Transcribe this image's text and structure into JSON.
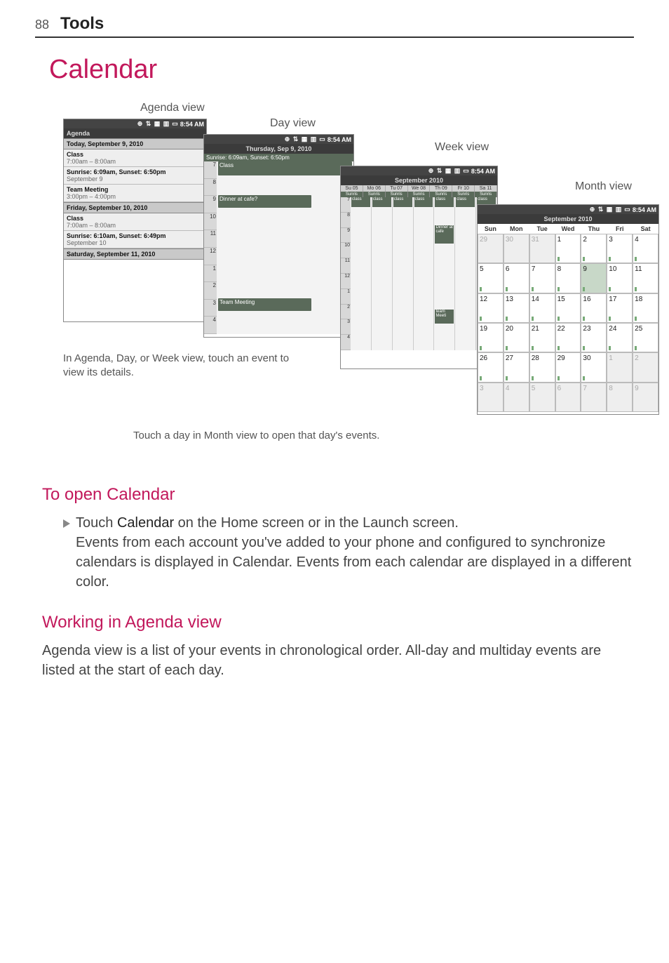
{
  "page": {
    "number": "88",
    "header": "Tools"
  },
  "title": "Calendar",
  "labels": {
    "agenda": "Agenda view",
    "day": "Day view",
    "week": "Week view",
    "month": "Month view"
  },
  "statusbar": {
    "icons": "⊕ ⇅ ▦ ▥",
    "battery": "▭",
    "time": "8:54 AM"
  },
  "agenda": {
    "title": "Agenda",
    "today": "Today, September 9, 2010",
    "items": [
      {
        "title": "Class",
        "sub": "7:00am – 8:00am"
      },
      {
        "title": "Sunrise: 6:09am, Sunset: 6:50pm",
        "sub": "September 9"
      },
      {
        "title": "Team Meeting",
        "sub": "3:00pm – 4:00pm"
      }
    ],
    "friday": "Friday, September 10, 2010",
    "friday_items": [
      {
        "title": "Class",
        "sub": "7:00am – 8:00am"
      },
      {
        "title": "Sunrise: 6:10am, Sunset: 6:49pm",
        "sub": "September 10"
      }
    ],
    "saturday": "Saturday, September 11, 2010"
  },
  "day": {
    "header": "Thursday, Sep 9, 2010",
    "sun": "Sunrise: 6:09am, Sunset: 6:50pm",
    "ev7": "Class",
    "ev9": "Dinner at cafe?",
    "ev3": "Team Meeting",
    "hours": [
      "7",
      "8",
      "9",
      "10",
      "11",
      "12",
      "1",
      "2",
      "3",
      "4"
    ]
  },
  "week": {
    "header": "September 2010",
    "days": [
      "Su 05",
      "Mo 06",
      "Tu 07",
      "We 08",
      "Th 09",
      "Fr 10",
      "Sa 11"
    ],
    "sun": [
      "Sunris",
      "Sunris",
      "Sunris",
      "Sunris",
      "Sunris",
      "Sunris",
      "Sunris"
    ],
    "class": [
      "class",
      "class",
      "class",
      "class",
      "class",
      "class",
      "class"
    ],
    "hours": [
      "7",
      "8",
      "9",
      "10",
      "11",
      "12",
      "1",
      "2",
      "3",
      "4"
    ],
    "dinner": "Dinner at cafe",
    "team": "team Meeti"
  },
  "month": {
    "header": "September 2010",
    "dow": [
      "Sun",
      "Mon",
      "Tue",
      "Wed",
      "Thu",
      "Fri",
      "Sat"
    ],
    "cells": [
      {
        "n": "29",
        "dim": true
      },
      {
        "n": "30",
        "dim": true
      },
      {
        "n": "31",
        "dim": true
      },
      {
        "n": "1"
      },
      {
        "n": "2"
      },
      {
        "n": "3"
      },
      {
        "n": "4"
      },
      {
        "n": "5"
      },
      {
        "n": "6"
      },
      {
        "n": "7"
      },
      {
        "n": "8"
      },
      {
        "n": "9",
        "today": true
      },
      {
        "n": "10"
      },
      {
        "n": "11"
      },
      {
        "n": "12"
      },
      {
        "n": "13"
      },
      {
        "n": "14"
      },
      {
        "n": "15"
      },
      {
        "n": "16"
      },
      {
        "n": "17"
      },
      {
        "n": "18"
      },
      {
        "n": "19"
      },
      {
        "n": "20"
      },
      {
        "n": "21"
      },
      {
        "n": "22"
      },
      {
        "n": "23"
      },
      {
        "n": "24"
      },
      {
        "n": "25"
      },
      {
        "n": "26"
      },
      {
        "n": "27"
      },
      {
        "n": "28"
      },
      {
        "n": "29"
      },
      {
        "n": "30"
      },
      {
        "n": "1",
        "dim": true
      },
      {
        "n": "2",
        "dim": true
      },
      {
        "n": "3",
        "dim": true
      },
      {
        "n": "4",
        "dim": true
      },
      {
        "n": "5",
        "dim": true
      },
      {
        "n": "6",
        "dim": true
      },
      {
        "n": "7",
        "dim": true
      },
      {
        "n": "8",
        "dim": true
      },
      {
        "n": "9",
        "dim": true
      }
    ]
  },
  "captions": {
    "left": "In Agenda, Day, or Week view, touch an event to view its details.",
    "bottom": "Touch a day in Month view to open that day's events."
  },
  "sections": {
    "open_title": "To open Calendar",
    "open_bullet_pre": "Touch ",
    "open_bullet_strong": "Calendar",
    "open_bullet_post": " on the Home screen or in the Launch screen.",
    "open_para": "Events from each account you've added to your phone and configured to synchronize calendars is displayed in Calendar. Events from each calendar are displayed in a different color.",
    "agenda_title": "Working in Agenda view",
    "agenda_para": "Agenda view is a list of your events in chronological order. All-day and multiday events are listed at the start of each day."
  }
}
